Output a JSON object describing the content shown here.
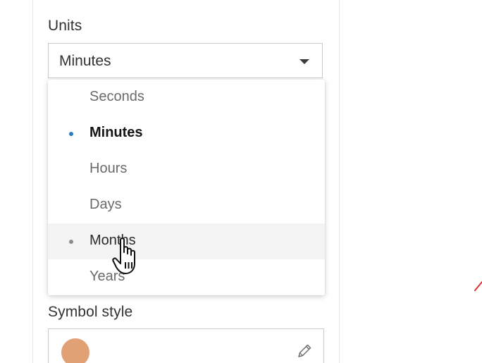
{
  "units": {
    "label": "Units",
    "selected_value": "Minutes",
    "options": [
      {
        "label": "Seconds"
      },
      {
        "label": "Minutes"
      },
      {
        "label": "Hours"
      },
      {
        "label": "Days"
      },
      {
        "label": "Months"
      },
      {
        "label": "Years"
      }
    ],
    "selected_option": "Minutes",
    "hovered_option": "Months"
  },
  "symbol_style": {
    "label": "Symbol style",
    "swatch_color": "#e0a274"
  },
  "colors": {
    "selected_dot": "#2b7ac4",
    "hover_dot": "#8c8c8c",
    "annotation_mark": "#e03030"
  },
  "icons": {
    "select_caret": "chevron-down-icon",
    "edit_symbol": "pencil-icon",
    "cursor": "hand-pointer-icon"
  }
}
